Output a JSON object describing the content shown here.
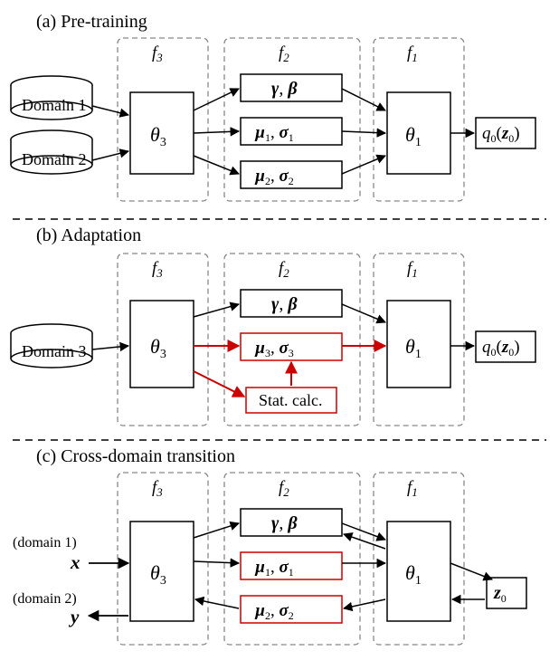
{
  "captions": {
    "a": "(a) Pre-training",
    "b": "(b) Adaptation",
    "c": "(c) Cross-domain transition"
  },
  "sources": {
    "d1": "Domain 1",
    "d2": "Domain 2",
    "d3": "Domain 3",
    "x_note": "(domain 1)",
    "y_note": "(domain 2)"
  },
  "groups": {
    "f3": "f",
    "f2": "f",
    "f1": "f"
  },
  "group_subs": {
    "f3": "3",
    "f2": "2",
    "f1": "1"
  },
  "blocks": {
    "theta3": "θ",
    "theta3_sub": "3",
    "theta1": "θ",
    "theta1_sub": "1",
    "gamma_beta_g": "γ",
    "gamma_beta_comma": ", ",
    "gamma_beta_b": "β",
    "mu1": "µ",
    "mu1_sub": "1",
    "sigma1": "σ",
    "sigma1_sub": "1",
    "mu2": "µ",
    "mu2_sub": "2",
    "sigma2": "σ",
    "sigma2_sub": "2",
    "mu3": "µ",
    "mu3_sub": "3",
    "sigma3": "σ",
    "sigma3_sub": "3",
    "stat": "Stat. calc.",
    "q0": "q",
    "q0_sub": "0",
    "z0": "z",
    "z0_sub": "0",
    "x": "x",
    "y": "y"
  }
}
